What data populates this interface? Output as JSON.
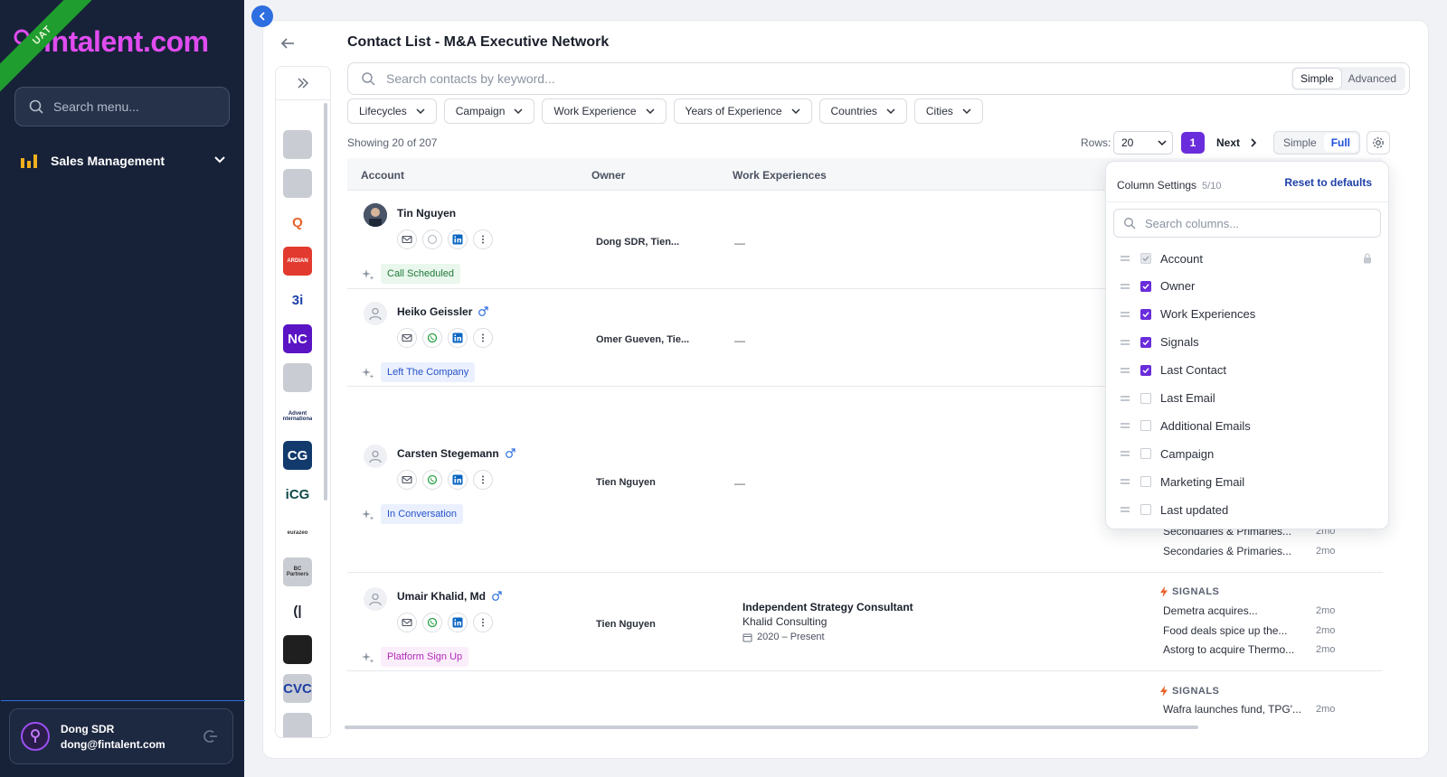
{
  "app": {
    "logo_text": "fintalent.com",
    "env_ribbon": "UAT",
    "menu_search_placeholder": "Search menu...",
    "nav_item": "Sales Management",
    "user_name": "Dong SDR",
    "user_email": "dong@fintalent.com"
  },
  "page": {
    "title": "Contact List - M&A Executive Network",
    "search_placeholder": "Search contacts by keyword...",
    "search_mode": {
      "simple": "Simple",
      "advanced": "Advanced",
      "active": "Simple"
    },
    "filters": [
      "Lifecycles",
      "Campaign",
      "Work Experience",
      "Years of Experience",
      "Countries",
      "Cities"
    ],
    "showing": "Showing 20 of 207",
    "rows_label": "Rows:",
    "rows_value": "20",
    "current_page": "1",
    "next_label": "Next",
    "view_toggle": {
      "simple": "Simple",
      "full": "Full",
      "active": "Full"
    }
  },
  "table": {
    "columns": {
      "account": "Account",
      "owner": "Owner",
      "work_experiences": "Work Experiences"
    },
    "rows": [
      {
        "name": "Tin Nguyen",
        "owner": "Dong SDR, Tien...",
        "work": "—",
        "badge": "Call Scheduled",
        "badge_color": "#e9f7ec",
        "badge_text": "#1f7a3a",
        "whatsapp_active": false
      },
      {
        "name": "Heiko Geissler",
        "owner": "Omer Gueven, Tie...",
        "work": "—",
        "badge": "Left The Company",
        "badge_color": "#eaf0fe",
        "badge_text": "#2552c9",
        "whatsapp_active": true
      },
      {
        "name": "Carsten Stegemann",
        "owner": "Tien Nguyen",
        "work": "—",
        "badge": "In Conversation",
        "badge_color": "#eaf0fe",
        "badge_text": "#2552c9",
        "whatsapp_active": true
      },
      {
        "name": "Umair Khalid, Md",
        "owner": "Tien Nguyen",
        "work_title": "Independent Strategy Consultant",
        "work_company": "Khalid Consulting",
        "work_dates": "2020 – Present",
        "badge": "Platform Sign Up",
        "badge_color": "#fbeefb",
        "badge_text": "#b02ab8",
        "whatsapp_active": true
      }
    ],
    "signals_header": "SIGNALS",
    "signals_row3_partial": [
      {
        "text": "Secondaries & Primaries...",
        "age": "2mo"
      },
      {
        "text": "Secondaries & Primaries...",
        "age": "2mo"
      }
    ],
    "signals_row4": [
      {
        "text": "Demetra acquires...",
        "age": "2mo"
      },
      {
        "text": "Food deals spice up the...",
        "age": "2mo"
      },
      {
        "text": "Astorg to acquire Thermo...",
        "age": "2mo"
      }
    ],
    "signals_row5": [
      {
        "text": "Wafra launches fund, TPG'...",
        "age": "2mo"
      }
    ]
  },
  "company_logos": [
    {
      "label": "",
      "bg": "#c9ccd2",
      "fg": "#2a3c8a"
    },
    {
      "label": "",
      "bg": "#c9ccd2",
      "fg": "#555"
    },
    {
      "label": "Q",
      "bg": "#ffffff",
      "fg": "#e8622a"
    },
    {
      "label": "ARDIAN",
      "bg": "#e23a2e",
      "fg": "#ffffff"
    },
    {
      "label": "3i",
      "bg": "#ffffff",
      "fg": "#1d3fa8"
    },
    {
      "label": "NC",
      "bg": "#5a14c4",
      "fg": "#ffffff"
    },
    {
      "label": "",
      "bg": "#c9ccd2",
      "fg": "#2e8b57"
    },
    {
      "label": "Advent International",
      "bg": "#ffffff",
      "fg": "#1a2a5a"
    },
    {
      "label": "CG",
      "bg": "#123a6d",
      "fg": "#ffffff"
    },
    {
      "label": "iCG",
      "bg": "#ffffff",
      "fg": "#0f4a4a"
    },
    {
      "label": "eurazeo",
      "bg": "#ffffff",
      "fg": "#333"
    },
    {
      "label": "BC Partners",
      "bg": "#c9ccd2",
      "fg": "#333"
    },
    {
      "label": "(|",
      "bg": "#ffffff",
      "fg": "#1a1f2b"
    },
    {
      "label": "",
      "bg": "#1f1f1f",
      "fg": "#e02a2a"
    },
    {
      "label": "CVC",
      "bg": "#c9ccd2",
      "fg": "#1d3fa8"
    },
    {
      "label": "",
      "bg": "#c9ccd2",
      "fg": "#555"
    }
  ],
  "column_settings": {
    "title": "Column Settings",
    "count": "5/10",
    "reset_label": "Reset to defaults",
    "search_placeholder": "Search columns...",
    "items": [
      {
        "label": "Account",
        "state": "locked"
      },
      {
        "label": "Owner",
        "state": "checked"
      },
      {
        "label": "Work Experiences",
        "state": "checked"
      },
      {
        "label": "Signals",
        "state": "checked"
      },
      {
        "label": "Last Contact",
        "state": "checked"
      },
      {
        "label": "Last Email",
        "state": "unchecked"
      },
      {
        "label": "Additional Emails",
        "state": "unchecked"
      },
      {
        "label": "Campaign",
        "state": "unchecked"
      },
      {
        "label": "Marketing Email",
        "state": "unchecked"
      },
      {
        "label": "Last updated",
        "state": "unchecked"
      }
    ]
  },
  "colors": {
    "accent": "#6a2ddb",
    "sidebar": "#172238",
    "brand": "#e04cf0",
    "link": "#1d3fa8"
  }
}
